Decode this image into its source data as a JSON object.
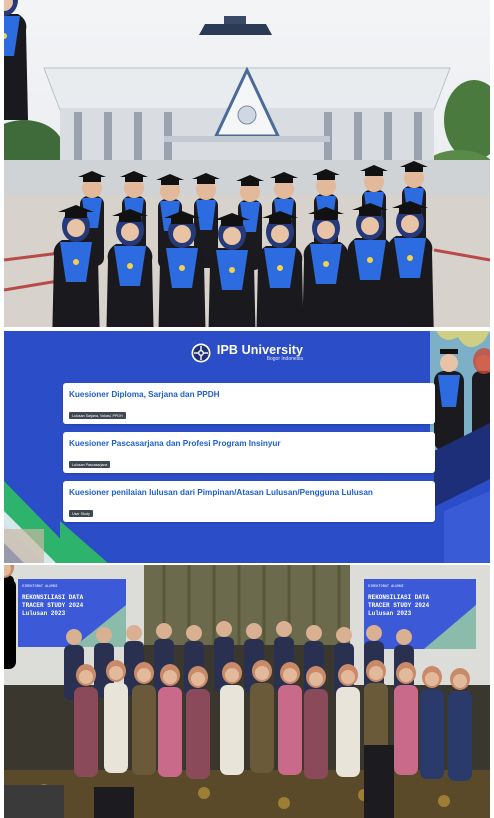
{
  "portal": {
    "brand_name": "IPB University",
    "brand_sub": "Bogor Indonesia",
    "cards": [
      {
        "title": "Kuesioner Diploma, Sarjana dan PPDH",
        "badge": "Lulusan Sarjana, Vokasi, PPDH"
      },
      {
        "title": "Kuesioner Pascasarjana dan Profesi Program Insinyur",
        "badge": "Lulusan Pascasarjana"
      },
      {
        "title": "Kuesioner penilaian lulusan dari Pimpinan/Atasan Lulusan/Pengguna Lulusan",
        "badge": "User Study"
      }
    ]
  },
  "workshop": {
    "screen_left": {
      "header": "DIREKTORAT ALUMNI",
      "lines": [
        "REKONSILIASI DATA",
        "TRACER STUDY 2024",
        "Lulusan 2023"
      ]
    },
    "screen_right": {
      "header": "DIREKTORAT ALUMNI",
      "lines": [
        "REKONSILIASI DATA",
        "TRACER STUDY 2024",
        "Lulusan 2023"
      ]
    }
  },
  "colors": {
    "portal_bg": "#2a4cc4",
    "card_title": "#1d5fd0",
    "badge_bg": "#3f4750",
    "gown_sash": "#2d6be0"
  }
}
